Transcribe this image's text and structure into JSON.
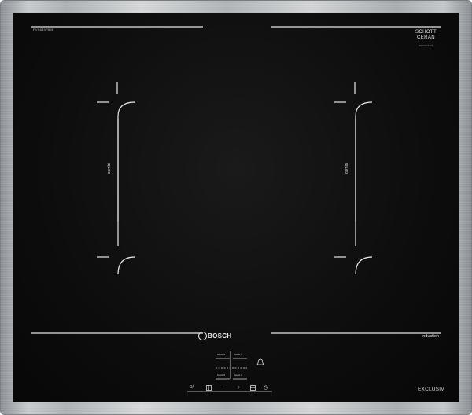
{
  "product": {
    "model_code": "PVS645FB5E",
    "glass_brand": "SCHOTT",
    "glass_brand_line2": "CERAN",
    "glass_sub": "MIRANTA®"
  },
  "zones": {
    "left_label": "combi",
    "right_label": "combi"
  },
  "branding": {
    "logo_text": "BOSCH",
    "type_label": "induction",
    "series_label": "EXCLUSIV"
  },
  "controls": {
    "boost_labels": [
      "boost S",
      "boost S",
      "boost S",
      "boost S"
    ],
    "power_symbol": "O/I",
    "minus_symbol": "−",
    "plus_symbol": "+",
    "timer_symbol": "◷"
  },
  "colors": {
    "glass": "#0d0d0d",
    "lines": "#e8e8e8",
    "frame": "#c0c3c5"
  }
}
